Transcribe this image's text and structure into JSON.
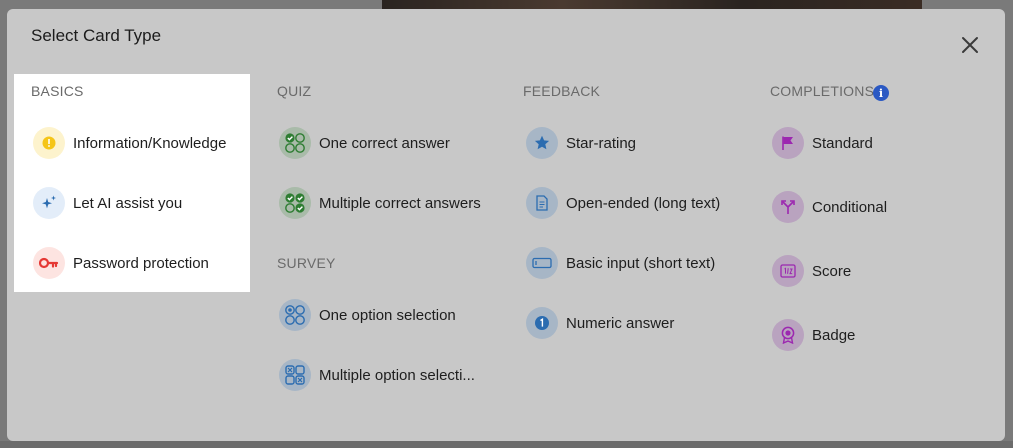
{
  "modal": {
    "title": "Select Card Type"
  },
  "basics": {
    "heading": "BASICS",
    "items": [
      {
        "label": "Information/Knowledge",
        "icon": "info-icon"
      },
      {
        "label": "Let AI assist you",
        "icon": "sparkle-icon"
      },
      {
        "label": "Password protection",
        "icon": "key-icon"
      }
    ]
  },
  "quiz": {
    "heading": "QUIZ",
    "items": [
      {
        "label": "One correct answer",
        "icon": "one-check-grid-icon"
      },
      {
        "label": "Multiple correct answers",
        "icon": "multi-check-grid-icon"
      }
    ]
  },
  "survey": {
    "heading": "SURVEY",
    "items": [
      {
        "label": "One option selection",
        "icon": "option-grid-icon"
      },
      {
        "label": "Multiple option selecti...",
        "icon": "multi-option-grid-icon"
      }
    ]
  },
  "feedback": {
    "heading": "FEEDBACK",
    "items": [
      {
        "label": "Star-rating",
        "icon": "star-icon"
      },
      {
        "label": "Open-ended (long text)",
        "icon": "document-icon"
      },
      {
        "label": "Basic input (short text)",
        "icon": "input-box-icon"
      },
      {
        "label": "Numeric answer",
        "icon": "number-one-icon"
      }
    ]
  },
  "completions": {
    "heading": "COMPLETIONS",
    "info_glyph": "i",
    "items": [
      {
        "label": "Standard",
        "icon": "flag-icon"
      },
      {
        "label": "Conditional",
        "icon": "split-arrow-icon"
      },
      {
        "label": "Score",
        "icon": "score-icon"
      },
      {
        "label": "Badge",
        "icon": "badge-icon"
      }
    ]
  },
  "colors": {
    "overlay": "#7a7a7a",
    "modal": "#c8c8c8",
    "basics_panel": "#ffffff",
    "quiz_green": "#2e7d32",
    "survey_blue": "#2b6cb0",
    "completion_purple": "#9c27b0",
    "key_red": "#e53935",
    "info_yellow": "#f5c518"
  }
}
